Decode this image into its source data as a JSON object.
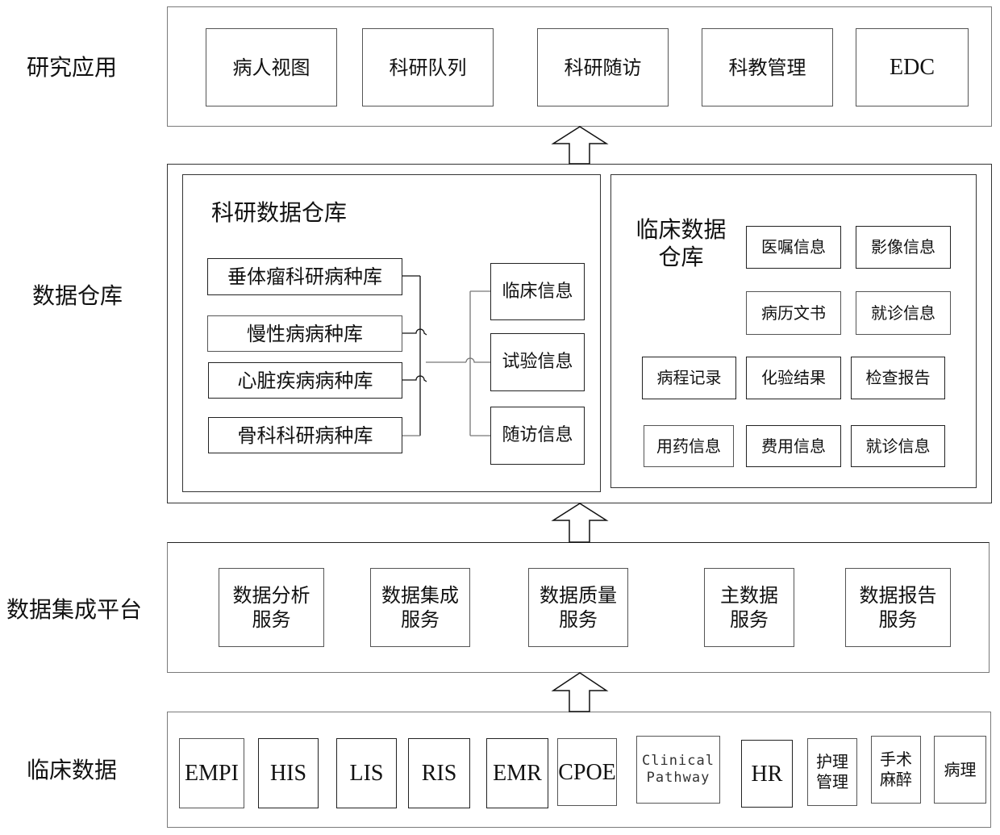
{
  "layers": {
    "research": {
      "label": "研究应用",
      "items": [
        "病人视图",
        "科研队列",
        "科研随访",
        "科教管理",
        "EDC"
      ]
    },
    "warehouse": {
      "label": "数据仓库",
      "research_dw": {
        "title": "科研数据仓库",
        "disease_libs": [
          "垂体瘤科研病种库",
          "慢性病病种库",
          "心脏疾病病种库",
          "骨科科研病种库"
        ],
        "info_types": [
          "临床信息",
          "试验信息",
          "随访信息"
        ]
      },
      "clinical_dw": {
        "title_line1": "临床数据",
        "title_line2": "仓库",
        "items": [
          "医嘱信息",
          "影像信息",
          "病历文书",
          "就诊信息",
          "病程记录",
          "化验结果",
          "检查报告",
          "用药信息",
          "费用信息",
          "就诊信息"
        ]
      }
    },
    "integration": {
      "label": "数据集成平台",
      "services": [
        {
          "line1": "数据分析",
          "line2": "服务"
        },
        {
          "line1": "数据集成",
          "line2": "服务"
        },
        {
          "line1": "数据质量",
          "line2": "服务"
        },
        {
          "line1": "主数据",
          "line2": "服务"
        },
        {
          "line1": "数据报告",
          "line2": "服务"
        }
      ]
    },
    "clinical": {
      "label": "临床数据",
      "systems": [
        "EMPI",
        "HIS",
        "LIS",
        "RIS",
        "EMR",
        "CPOE"
      ],
      "clinical_pathway": {
        "line1": "Clinical",
        "line2": "Pathway"
      },
      "hr": "HR",
      "nursing": {
        "line1": "护理",
        "line2": "管理"
      },
      "surgery": {
        "line1": "手术",
        "line2": "麻醉"
      },
      "pathology": "病理"
    }
  }
}
